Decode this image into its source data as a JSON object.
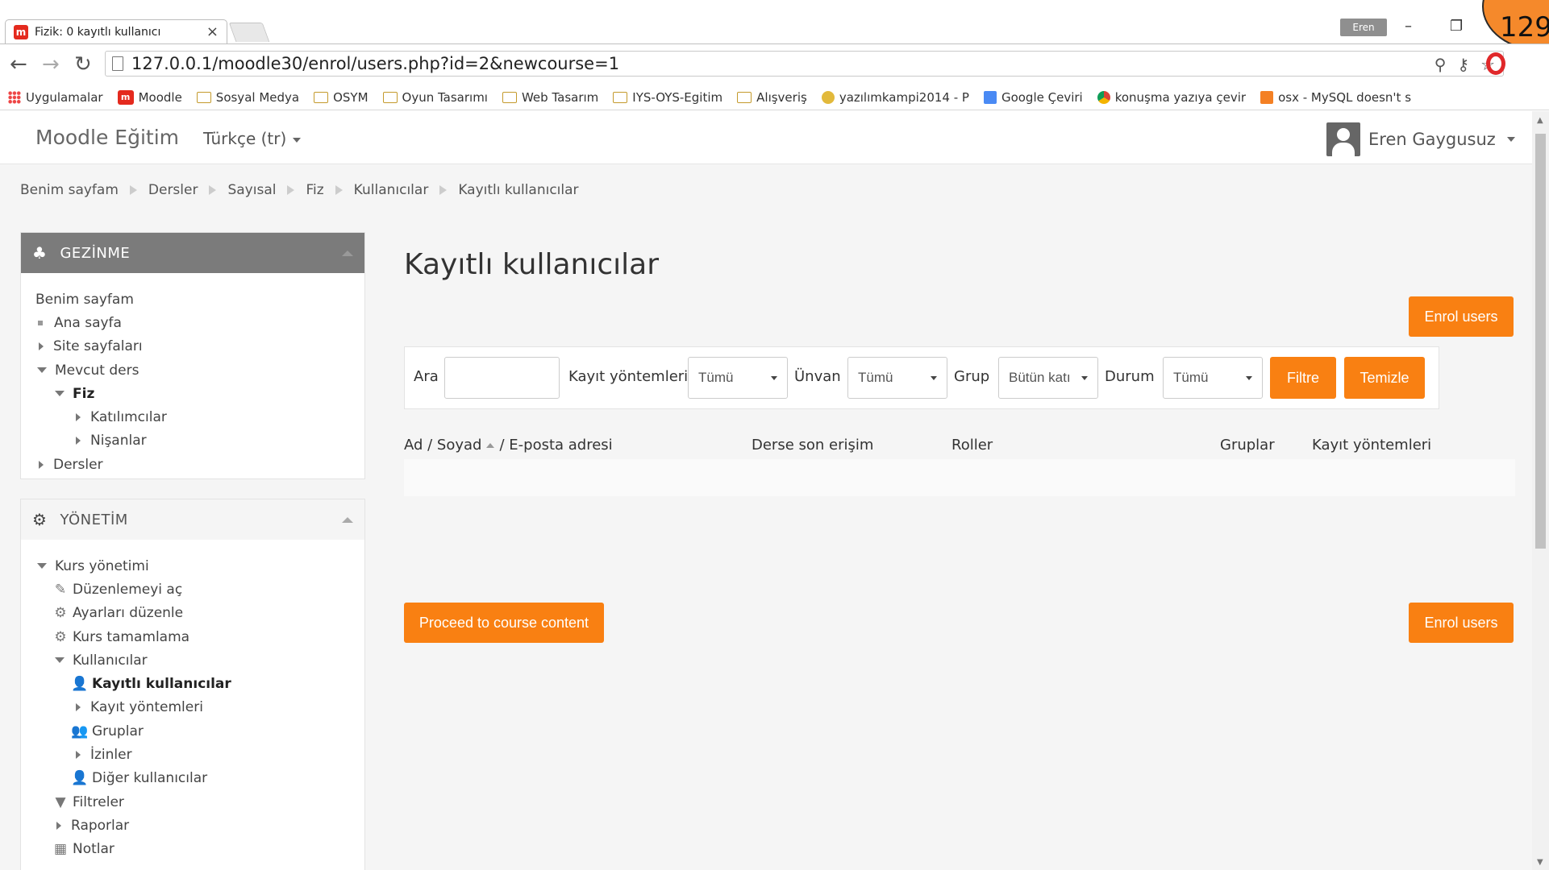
{
  "browser": {
    "tab_title": "Fizik: 0 kayıtlı kullanıcı",
    "tab_favicon": "m",
    "tab_close": "×",
    "user_chip": "Eren",
    "counter": "129",
    "url": "127.0.0.1/moodle30/enrol/users.php?id=2&newcourse=1",
    "window_min": "–",
    "window_restore": "❐",
    "bookmarks": [
      "Uygulamalar",
      "Moodle",
      "Sosyal Medya",
      "OSYM",
      "Oyun Tasarımı",
      "Web Tasarım",
      "IYS-OYS-Egitim",
      "Alışveriş",
      "yazılımkampi2014 - P",
      "Google Çeviri",
      "konuşma yazıya çevir",
      "osx - MySQL doesn't s"
    ]
  },
  "navbar": {
    "brand": "Moodle Eğitim",
    "language": "Türkçe (tr)",
    "user": "Eren Gaygusuz"
  },
  "breadcrumb": [
    "Benim sayfam",
    "Dersler",
    "Sayısal",
    "Fiz",
    "Kullanıcılar",
    "Kayıtlı kullanıcılar"
  ],
  "nav_block": {
    "title": "GEZİNME",
    "items": [
      "Benim sayfam",
      "Ana sayfa",
      "Site sayfaları",
      "Mevcut ders",
      "Fiz",
      "Katılımcılar",
      "Nişanlar",
      "Dersler"
    ]
  },
  "admin_block": {
    "title": "YÖNETİM",
    "items": [
      "Kurs yönetimi",
      "Düzenlemeyi aç",
      "Ayarları düzenle",
      "Kurs tamamlama",
      "Kullanıcılar",
      "Kayıtlı kullanıcılar",
      "Kayıt yöntemleri",
      "Gruplar",
      "İzinler",
      "Diğer kullanıcılar",
      "Filtreler",
      "Raporlar",
      "Notlar"
    ]
  },
  "main": {
    "title": "Kayıtlı kullanıcılar",
    "enrol_button": "Enrol users",
    "proceed_button": "Proceed to course content",
    "filter": {
      "search_label": "Ara",
      "search_value": "",
      "method_label": "Kayıt yöntemleri",
      "method_value": "Tümü",
      "role_label": "Ünvan",
      "role_value": "Tümü",
      "group_label": "Grup",
      "group_value": "Bütün katı",
      "status_label": "Durum",
      "status_value": "Tümü",
      "filter_button": "Filtre",
      "clear_button": "Temizle"
    },
    "table": {
      "col_name": "Ad / Soyad",
      "col_email": "/ E-posta adresi",
      "col_access": "Derse son erişim",
      "col_roles": "Roller",
      "col_groups": "Gruplar",
      "col_methods": "Kayıt yöntemleri"
    }
  },
  "colors": {
    "accent": "#f98012",
    "nav_header": "#7b7b7b"
  }
}
